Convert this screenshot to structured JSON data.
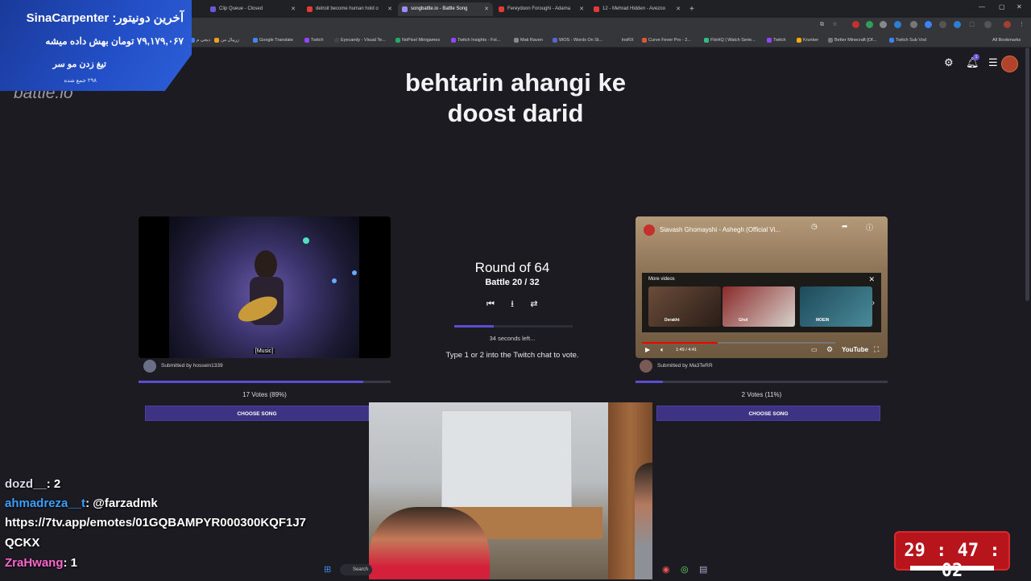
{
  "browser": {
    "tabs": [
      {
        "label": "Clip Queue - Closed",
        "color": "#6e54d6"
      },
      {
        "label": "detroit become human hold o",
        "color": "#e53935"
      },
      {
        "label": "songbattle.io - Battle Song",
        "color": "#9b8cff",
        "active": true
      },
      {
        "label": "Fereydoon Foroughi - Adama",
        "color": "#e53935"
      },
      {
        "label": "12 - Mehrad Hidden - Avezoo",
        "color": "#e53935"
      }
    ],
    "new_tab": "+",
    "bookmarks": [
      {
        "label": "دیجی م",
        "color": "#3b82f6"
      },
      {
        "label": "زرپیال من",
        "color": "#f0a020"
      },
      {
        "label": "Google Translate",
        "color": "#4285f4"
      },
      {
        "label": "Twitch",
        "color": "#9146ff"
      },
      {
        "label": "Eyecandy - Visual Te...",
        "color": "#444444"
      },
      {
        "label": "NoPixel Minigames",
        "color": "#22aa66"
      },
      {
        "label": "Twitch Insights - Fol...",
        "color": "#9146ff"
      },
      {
        "label": "Mak Raven",
        "color": "#888888"
      },
      {
        "label": "WOS - Words On St...",
        "color": "#5566cc"
      },
      {
        "label": "lnsRX",
        "color": "#333333"
      },
      {
        "label": "Curve Fever Pro - 2...",
        "color": "#dd5533"
      },
      {
        "label": "FlixHQ | Watch Serie...",
        "color": "#33bb88"
      },
      {
        "label": "Twitch",
        "color": "#9146ff"
      },
      {
        "label": "Krunker",
        "color": "#ffaa00"
      },
      {
        "label": "Better Minecraft [Of...",
        "color": "#777777"
      },
      {
        "label": "Twitch Sub Vod",
        "color": "#3b82f6"
      }
    ],
    "all_bookmarks": "All Bookmarks"
  },
  "site": {
    "logo": "battle.io",
    "title_line1": "behtarin ahangi ke",
    "title_line2": "doost darid",
    "notification_count": "1"
  },
  "battle": {
    "round": "Round of 64",
    "battle_label": "Battle 20 / 32",
    "seconds_left": "34 seconds left...",
    "instruction": "Type 1 or 2 into the Twitch chat to vote.",
    "timer_fraction": 0.33
  },
  "left_song": {
    "caption": "[Music]",
    "submitted_by": "Submitted by hossein1339",
    "votes": "17 Votes (89%)",
    "vote_fraction": 0.89,
    "choose_label": "CHOOSE SONG"
  },
  "right_song": {
    "video_title": "Siavash Ghomayshi - Ashegh (Official Vi...",
    "more_videos": "More videos",
    "thumbs": [
      "Derakht",
      "Ghol",
      "MOEIN"
    ],
    "time": "1:49 / 4:41",
    "progress_fraction": 0.39,
    "yt_logo": "YouTube",
    "submitted_by": "Submitted by Ma3TeRR",
    "votes": "2 Votes (11%)",
    "vote_fraction": 0.11,
    "choose_label": "CHOOSE SONG"
  },
  "donation": {
    "title": "آخرین دونیتور: SinaCarpenter",
    "amount": "۷۹,۱۷۹,۰۶۷ تومان بهش داده میشه",
    "message": "تیغ زدن مو سر",
    "total": "۲۹۸ جمع شده"
  },
  "chat": [
    {
      "user": "dozd__",
      "text": ": 2",
      "color": "#d7d7e8"
    },
    {
      "user": "ahmadreza__t",
      "text": ": @farzadmk",
      "color": "#3aa0ff"
    },
    {
      "user": "",
      "text": "https://7tv.app/emotes/01GQBAMPYR000300KQF1J7",
      "color": "#ffffff"
    },
    {
      "user": "",
      "text": "QCKX",
      "color": "#ffffff"
    },
    {
      "user": "ZraHwang",
      "text": ": 1",
      "color": "#ff66cc"
    }
  ],
  "stream_clock": "29 : 47 : 02",
  "taskbar": {
    "search": "Search"
  }
}
